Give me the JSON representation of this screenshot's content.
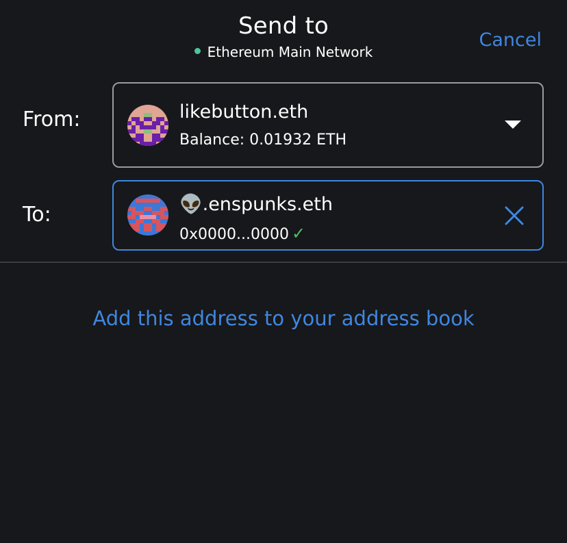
{
  "header": {
    "title": "Send to",
    "network": "Ethereum Main Network",
    "network_dot_color": "#4cc59b",
    "cancel_label": "Cancel"
  },
  "from": {
    "label": "From:",
    "account_name": "likebutton.eth",
    "balance": "Balance: 0.01932 ETH",
    "dropdown_icon": "caret-down-icon"
  },
  "to": {
    "label": "To:",
    "account_name": "👽.enspunks.eth",
    "address": "0x0000...0000",
    "verified_icon": "check-icon",
    "verified_mark": "✓",
    "clear_icon": "close-icon"
  },
  "add_address_link": "Add this address to your address book",
  "colors": {
    "background": "#17181b",
    "accent": "#3f87e0",
    "success": "#4fbf62",
    "border": "#9a9b9f"
  }
}
